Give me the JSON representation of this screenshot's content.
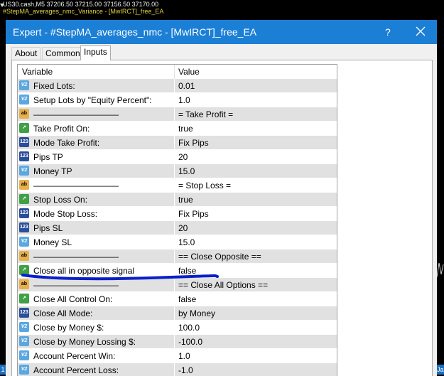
{
  "chart": {
    "title": "US30.cash,M5  37206.50 37215.00 37156.50 37170.00",
    "indicator": "#StepMA_averages_nmc_Variance - [MwIRCT]_free_EA",
    "left_tag": "1",
    "right_tag": "Ja"
  },
  "dialog": {
    "title": "Expert - #StepMA_averages_nmc - [MwIRCT]_free_EA",
    "help_label": "?",
    "close_icon": "close-icon",
    "accent_color": "#1c7fd6"
  },
  "tabs": [
    {
      "label": "About"
    },
    {
      "label": "Common"
    },
    {
      "label": "Inputs",
      "active": true
    }
  ],
  "grid": {
    "col_variable": "Variable",
    "col_value": "Value",
    "rows": [
      {
        "icon": "v2",
        "variable": "Fixed Lots:",
        "value": "0.01"
      },
      {
        "icon": "v2",
        "variable": "Setup Lots by \"Equity Percent\":",
        "value": "1.0"
      },
      {
        "icon": "ab",
        "variable": "——————————",
        "value": "= Take Profit ="
      },
      {
        "icon": "chk",
        "variable": "Take Profit On:",
        "value": "true"
      },
      {
        "icon": "n123",
        "variable": "Mode Take Profit:",
        "value": "Fix Pips"
      },
      {
        "icon": "n123",
        "variable": "Pips TP",
        "value": "20"
      },
      {
        "icon": "v2",
        "variable": "Money TP",
        "value": "15.0"
      },
      {
        "icon": "ab",
        "variable": "——————————",
        "value": "= Stop Loss ="
      },
      {
        "icon": "chk",
        "variable": "Stop Loss On:",
        "value": "true"
      },
      {
        "icon": "n123",
        "variable": "Mode Stop Loss:",
        "value": "Fix Pips"
      },
      {
        "icon": "n123",
        "variable": "Pips SL",
        "value": "20"
      },
      {
        "icon": "v2",
        "variable": "Money SL",
        "value": "15.0"
      },
      {
        "icon": "ab",
        "variable": "——————————",
        "value": "== Close Opposite =="
      },
      {
        "icon": "chk",
        "variable": "Close all in opposite signal",
        "value": "false"
      },
      {
        "icon": "ab",
        "variable": "——————————",
        "value": "== Close All Options =="
      },
      {
        "icon": "chk",
        "variable": "Close All Control On:",
        "value": "false"
      },
      {
        "icon": "n123",
        "variable": "Close All Mode:",
        "value": "by Money"
      },
      {
        "icon": "v2",
        "variable": "Close by Money $:",
        "value": "100.0"
      },
      {
        "icon": "v2",
        "variable": "Close by Money Lossing $:",
        "value": "-100.0"
      },
      {
        "icon": "v2",
        "variable": "Account Percent Win:",
        "value": "1.0"
      },
      {
        "icon": "v2",
        "variable": "Account Percent Loss:",
        "value": "-1.0"
      }
    ],
    "icon_text": {
      "v2": "V2",
      "ab": "ab",
      "n123": "123",
      "chk": "↗"
    }
  },
  "annotation_color": "#0a1fc9"
}
